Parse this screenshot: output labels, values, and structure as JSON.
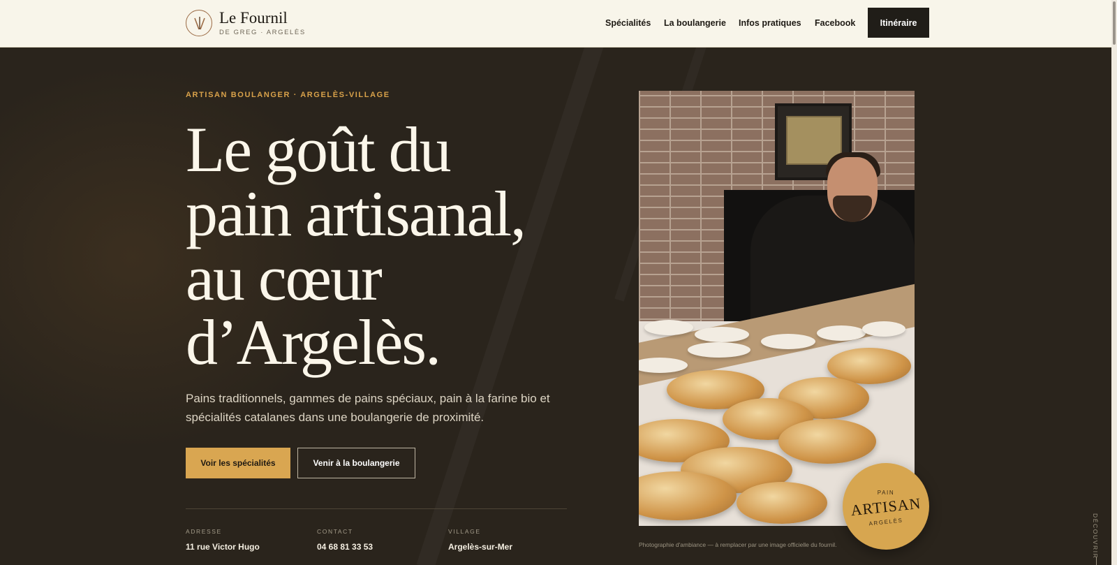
{
  "header": {
    "brand_name": "Le Fournil",
    "brand_sub": "DE GREG · ARGELÈS",
    "nav": [
      "Spécialités",
      "La boulangerie",
      "Infos pratiques",
      "Facebook"
    ],
    "cta": "Itinéraire"
  },
  "hero": {
    "eyebrow": "ARTISAN BOULANGER · ARGELÈS-VILLAGE",
    "headline": [
      "Le goût du",
      "pain artisanal,",
      "au cœur",
      "d’Argelès."
    ],
    "lead": "Pains traditionnels, gammes de pains spéciaux, pain à la farine bio et spécialités catalanes dans une boulangerie de proximité.",
    "primary_button": "Voir les spécialités",
    "secondary_button": "Venir à la boulangerie",
    "info": [
      {
        "label": "ADRESSE",
        "value": "11 rue Victor Hugo"
      },
      {
        "label": "CONTACT",
        "value": "04 68 81 33 53"
      },
      {
        "label": "VILLAGE",
        "value": "Argelès-sur-Mer"
      }
    ]
  },
  "photo": {
    "caption": "Photographie d'ambiance — à remplacer par une image officielle du fournil.",
    "badge": {
      "top": "PAIN",
      "main": "ARTISAN",
      "bottom": "ARGELÈS"
    }
  },
  "scroll_hint": "DÉCOUVRIR",
  "colors": {
    "accent": "#d9a651",
    "dark": "#201d18",
    "header_bg": "#f8f5ea",
    "hero_bg": "#2a241c"
  },
  "icons": {
    "logo": "wheat-icon"
  }
}
